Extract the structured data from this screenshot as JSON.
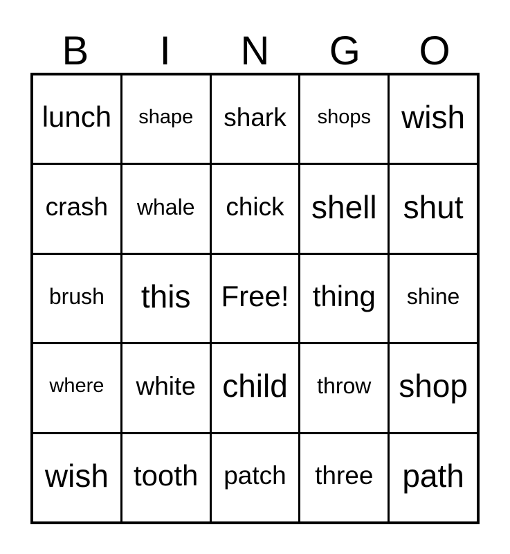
{
  "card": {
    "title": "BINGO",
    "header_letters": [
      "B",
      "I",
      "N",
      "G",
      "O"
    ],
    "free_space_label": "Free!",
    "colors": {
      "background": "#ffffff",
      "text": "#000000",
      "border": "#000000"
    },
    "grid": {
      "columns": 5,
      "rows": 5,
      "rows_data": [
        [
          {
            "text": "lunch",
            "size": "lg"
          },
          {
            "text": "shape",
            "size": "xs"
          },
          {
            "text": "shark",
            "size": "md"
          },
          {
            "text": "shops",
            "size": "xs"
          },
          {
            "text": "wish",
            "size": "xl"
          }
        ],
        [
          {
            "text": "crash",
            "size": "md"
          },
          {
            "text": "whale",
            "size": "sm"
          },
          {
            "text": "chick",
            "size": "md"
          },
          {
            "text": "shell",
            "size": "xl"
          },
          {
            "text": "shut",
            "size": "xl"
          }
        ],
        [
          {
            "text": "brush",
            "size": "sm"
          },
          {
            "text": "this",
            "size": "xl"
          },
          {
            "text": "Free!",
            "size": "lg"
          },
          {
            "text": "thing",
            "size": "lg"
          },
          {
            "text": "shine",
            "size": "sm"
          }
        ],
        [
          {
            "text": "where",
            "size": "xs"
          },
          {
            "text": "white",
            "size": "md"
          },
          {
            "text": "child",
            "size": "xl"
          },
          {
            "text": "throw",
            "size": "sm"
          },
          {
            "text": "shop",
            "size": "xl"
          }
        ],
        [
          {
            "text": "wish",
            "size": "xl"
          },
          {
            "text": "tooth",
            "size": "lg"
          },
          {
            "text": "patch",
            "size": "md"
          },
          {
            "text": "three",
            "size": "md"
          },
          {
            "text": "path",
            "size": "xl"
          }
        ]
      ]
    }
  }
}
